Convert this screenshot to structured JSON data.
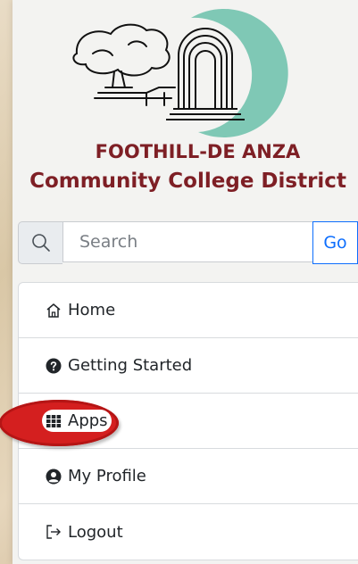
{
  "brand": {
    "line1": "FOOTHILL-DE ANZA",
    "line2": "Community College District"
  },
  "search": {
    "placeholder": "Search",
    "go_label": "Go",
    "icon": "search-icon"
  },
  "menu": {
    "items": [
      {
        "label": "Home",
        "icon": "home-icon"
      },
      {
        "label": "Getting Started",
        "icon": "question-circle-icon"
      },
      {
        "label": "Apps",
        "icon": "grid-icon",
        "highlighted": true
      },
      {
        "label": "My Profile",
        "icon": "user-circle-icon"
      },
      {
        "label": "Logout",
        "icon": "logout-icon"
      }
    ]
  },
  "colors": {
    "brand": "#7e1f25",
    "accent": "#0d6efd",
    "highlight": "#d41f1f",
    "logo_ring": "#7fc8b5"
  }
}
